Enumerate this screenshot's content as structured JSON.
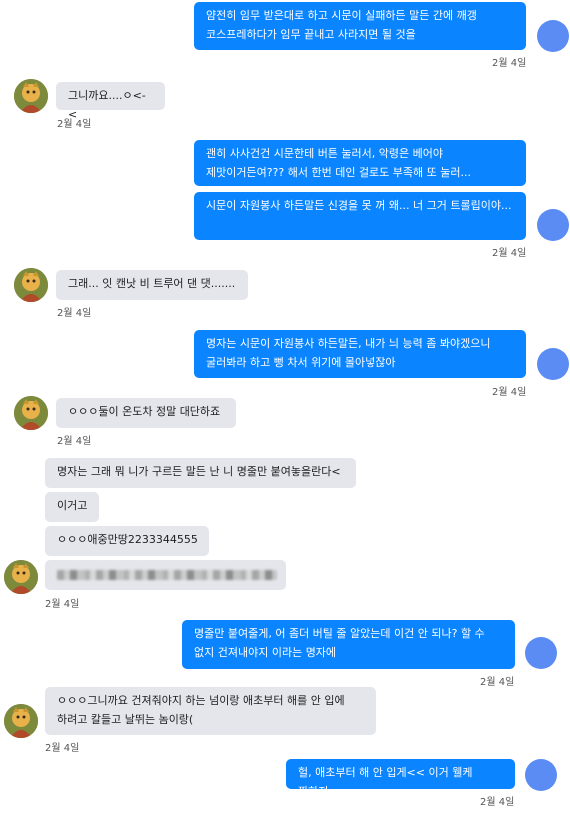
{
  "messages": {
    "m1": "얌전히 임무 받은대로 하고 시문이 실패하든 말든 간에 깨갱 코스프레하다가 임무 끝내고 사라지면 될 것을",
    "m2": "그니까요....ㅇ<-<",
    "m3": "괜히 사사건건 시문한테 버튼 눌러서, 악령은 베어야 제맛이거든여??? 해서 한번 데인 걸로도 부족해 또 눌러...",
    "m4": "시문이 자원봉사 하든말든 신경을 못 꺼 왜... 너 그거 트롤립이야...",
    "m5": "그래... 잇 캔낫 비 트루어 댄 댓.......",
    "m6": "명자는 시문이 자원봉사 하든말든, 내가 늬 능력 좀 봐야겠으니 굴러봐라 하고 뻥 차서 위기에 몰아넣잖아",
    "m7": "ㅇㅇㅇ둘이 온도차 정말 대단하죠",
    "m8": "명자는 그래 뭐 니가 구르든 말든 난 니 명줄만 붙여놓을란다<",
    "m9": "이거고",
    "m10": "ㅇㅇㅇ애중만땅2233344555",
    "m12": "명줄만 붙여줄게, 어 좀더 버틸 줄 알았는데 이건 안 되나? 할 수 없지 건져내야지 이라는 명자에",
    "m13": "ㅇㅇㅇ그니까요 건져줘야지 하는 넘이랑 애초부터 해를 안 입에 하려고 칼들고 날뛰는 놈이랑(",
    "m14": "헐, 애초부터 해 안 입게<< 이거 웰케 짠하져"
  },
  "timestamps": {
    "t1": "2월 4일",
    "t2": "2월 4일",
    "t3": "2월 4일",
    "t4": "2월 4일",
    "t5": "2월 4일",
    "t6": "2월 4일",
    "t7": "2월 4일",
    "t8": "2월 4일",
    "t9": "2월 4일",
    "t10": "2월 4일",
    "t11": "2월 4일",
    "t12": "2월 4일"
  },
  "colors": {
    "outgoing_bubble": "#0a84ff",
    "incoming_bubble": "#e4e6eb",
    "self_avatar": "#5b8cf3"
  },
  "icons": {
    "self_avatar": "blue-circle-avatar",
    "other_avatar": "character-photo-avatar"
  }
}
